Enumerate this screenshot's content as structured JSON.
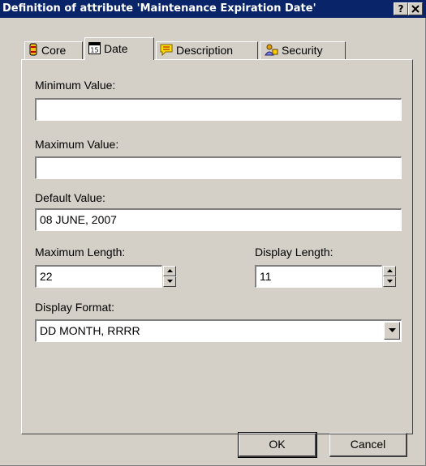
{
  "window": {
    "title": "Definition of attribute 'Maintenance Expiration Date'",
    "help_label": "?",
    "close_label": "✕"
  },
  "tabs": [
    {
      "label": "Core",
      "icon": "core-icon",
      "active": false
    },
    {
      "label": "Date",
      "icon": "calendar-icon",
      "active": true
    },
    {
      "label": "Description",
      "icon": "description-icon",
      "active": false
    },
    {
      "label": "Security",
      "icon": "security-icon",
      "active": false
    }
  ],
  "form": {
    "minimum_value": {
      "label": "Minimum Value:",
      "value": ""
    },
    "maximum_value": {
      "label": "Maximum Value:",
      "value": ""
    },
    "default_value": {
      "label": "Default Value:",
      "value": "08 JUNE, 2007"
    },
    "maximum_length": {
      "label": "Maximum Length:",
      "value": "22"
    },
    "display_length": {
      "label": "Display Length:",
      "value": "11"
    },
    "display_format": {
      "label": "Display Format:",
      "value": "DD MONTH, RRRR"
    }
  },
  "buttons": {
    "ok": "OK",
    "cancel": "Cancel"
  },
  "colors": {
    "titlebar": "#0a246a",
    "face": "#d4d0c8",
    "field": "#ffffff"
  }
}
